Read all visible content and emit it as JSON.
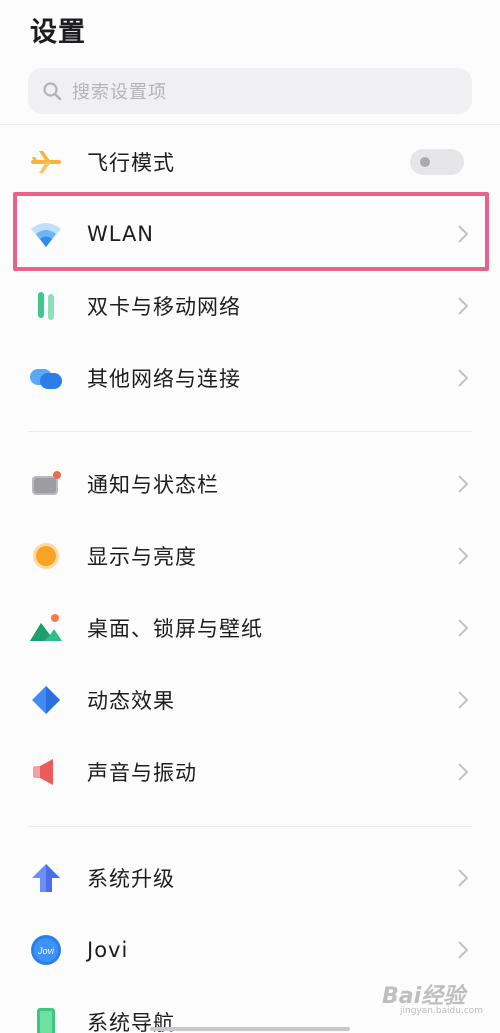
{
  "header": {
    "title": "设置"
  },
  "search": {
    "placeholder": "搜索设置项"
  },
  "items": [
    {
      "label": "飞行模式",
      "icon": "airplane-icon",
      "toggle": "off"
    },
    {
      "label": "WLAN",
      "icon": "wifi-icon",
      "highlighted": true
    },
    {
      "label": "双卡与移动网络",
      "icon": "dual-sim-icon"
    },
    {
      "label": "其他网络与连接",
      "icon": "connection-icon"
    },
    {
      "label": "通知与状态栏",
      "icon": "notification-icon"
    },
    {
      "label": "显示与亮度",
      "icon": "brightness-icon"
    },
    {
      "label": "桌面、锁屏与壁纸",
      "icon": "wallpaper-icon"
    },
    {
      "label": "动态效果",
      "icon": "animation-icon"
    },
    {
      "label": "声音与振动",
      "icon": "speaker-icon"
    },
    {
      "label": "系统升级",
      "icon": "upgrade-icon"
    },
    {
      "label": "Jovi",
      "icon": "jovi-icon",
      "icon_text": "Jovi"
    },
    {
      "label": "系统导航",
      "icon": "navigation-icon"
    }
  ],
  "watermark": {
    "text": "Bai经验",
    "sub": "jingyan.baidu.com"
  },
  "colors": {
    "highlight": "#e8628b",
    "accent": "#3f8cf5"
  }
}
